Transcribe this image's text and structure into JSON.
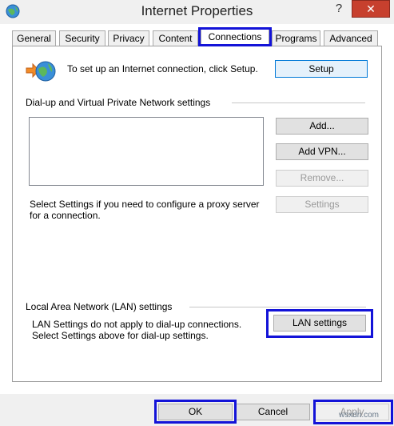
{
  "window": {
    "title": "Internet Properties",
    "help_label": "?",
    "close_label": "✕"
  },
  "tabs": [
    {
      "label": "General"
    },
    {
      "label": "Security"
    },
    {
      "label": "Privacy"
    },
    {
      "label": "Content"
    },
    {
      "label": "Connections"
    },
    {
      "label": "Programs"
    },
    {
      "label": "Advanced"
    }
  ],
  "active_tab": "Connections",
  "setup": {
    "text": "To set up an Internet connection, click Setup.",
    "button": "Setup"
  },
  "dialup": {
    "group_label": "Dial-up and Virtual Private Network settings",
    "add_button": "Add...",
    "add_vpn_button": "Add VPN...",
    "remove_button": "Remove...",
    "settings_text": "Select Settings if you need to configure a proxy server for a connection.",
    "settings_button": "Settings"
  },
  "lan": {
    "group_label": "Local Area Network (LAN) settings",
    "text": "LAN Settings do not apply to dial-up connections. Select Settings above for dial-up settings.",
    "button": "LAN settings"
  },
  "footer": {
    "ok_button": "OK",
    "cancel_button": "Cancel",
    "apply_button": "Apply"
  },
  "watermark": "wsxdn.com",
  "colors": {
    "highlight": "#1313d8",
    "close_button": "#c7402e"
  }
}
